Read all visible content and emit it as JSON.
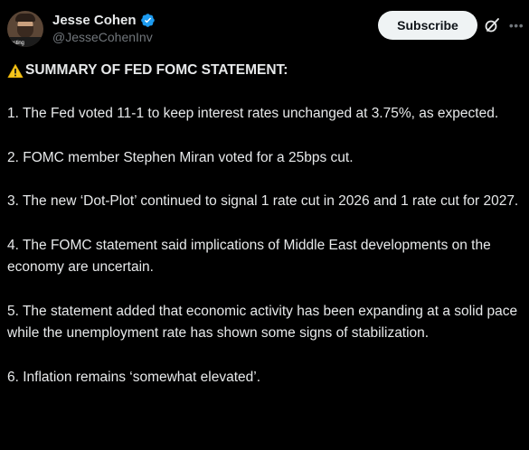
{
  "author": {
    "display_name": "Jesse Cohen",
    "handle": "@JesseCohenInv",
    "avatar_caption": "vesting"
  },
  "actions": {
    "subscribe_label": "Subscribe",
    "grok_icon": "grok-slash-icon",
    "more_icon": "ellipsis-icon"
  },
  "post": {
    "title": "SUMMARY OF FED FOMC STATEMENT:",
    "title_icon": "warning-icon",
    "points": [
      "1. The Fed voted 11-1 to keep interest rates unchanged at 3.75%, as expected.",
      "2. FOMC member Stephen Miran voted for a 25bps cut.",
      "3. The new ‘Dot-Plot’ continued to signal 1 rate cut in 2026 and 1 rate cut for 2027.",
      "4. The FOMC statement said implications of Middle East developments on the economy are uncertain.",
      "5. The statement added that economic activity has been expanding at a solid pace while the unemployment rate has shown some signs of stabilization.",
      "6. Inflation remains ‘somewhat elevated’."
    ]
  },
  "colors": {
    "background": "#000000",
    "text": "#e7e9ea",
    "muted": "#71767b",
    "verified_blue": "#1d9bf0",
    "button_bg": "#eff3f4"
  }
}
